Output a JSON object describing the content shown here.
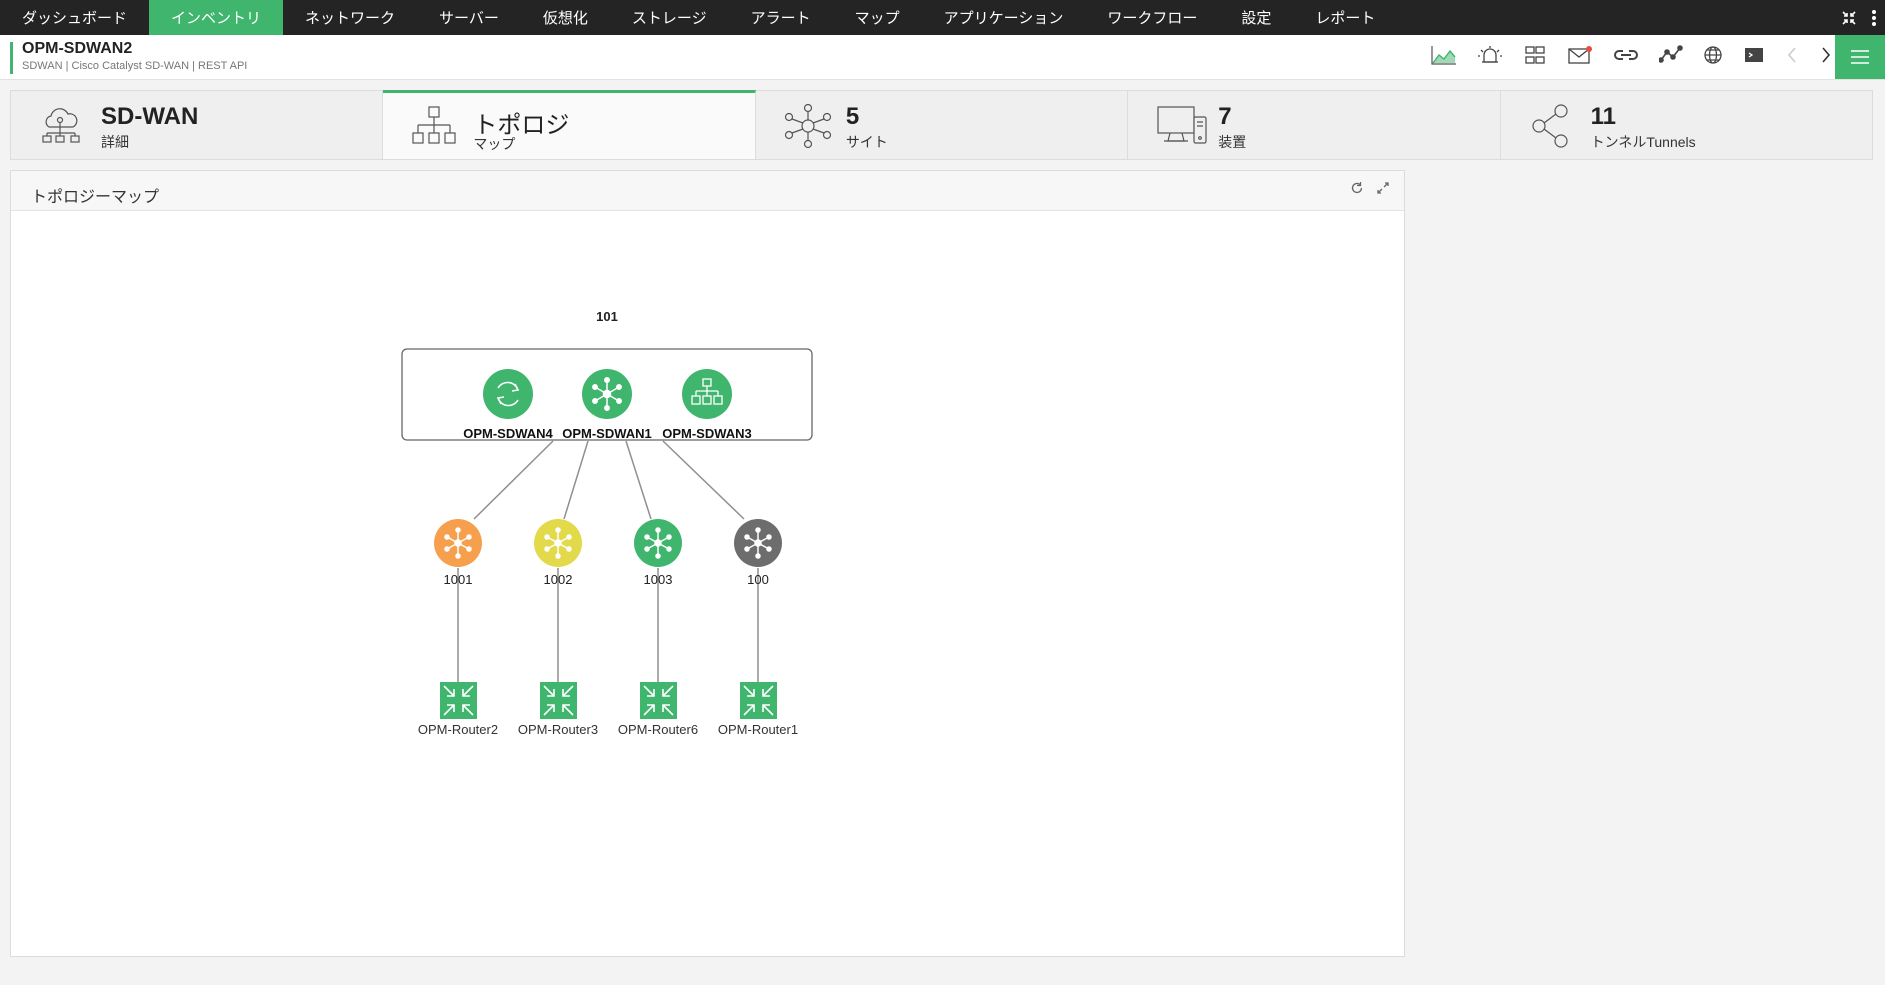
{
  "nav": {
    "items": [
      "ダッシュボード",
      "インベントリ",
      "ネットワーク",
      "サーバー",
      "仮想化",
      "ストレージ",
      "アラート",
      "マップ",
      "アプリケーション",
      "ワークフロー",
      "設定",
      "レポート"
    ],
    "active_index": 1
  },
  "header": {
    "title": "OPM-SDWAN2",
    "subtitle": "SDWAN | Cisco Catalyst SD-WAN | REST API"
  },
  "summary": [
    {
      "value": "SD-WAN",
      "label": "詳細",
      "icon": "cloud-network-icon"
    },
    {
      "value": "トポロジ",
      "label": "マップ",
      "icon": "topology-icon"
    },
    {
      "value": "5",
      "label": "サイト",
      "icon": "hub-icon"
    },
    {
      "value": "7",
      "label": "装置",
      "icon": "devices-icon"
    },
    {
      "value": "11",
      "label": "トンネルTunnels",
      "icon": "share-icon"
    }
  ],
  "panel": {
    "title": "トポロジーマップ"
  },
  "topology": {
    "group_label": "101",
    "controllers": [
      {
        "name": "OPM-SDWAN4",
        "icon": "sync-icon",
        "color": "#3fb56e"
      },
      {
        "name": "OPM-SDWAN1",
        "icon": "hub-icon",
        "color": "#3fb56e"
      },
      {
        "name": "OPM-SDWAN3",
        "icon": "topology-icon",
        "color": "#3fb56e"
      }
    ],
    "sites": [
      {
        "name": "1001",
        "color": "#f6a04d"
      },
      {
        "name": "1002",
        "color": "#e2d94b"
      },
      {
        "name": "1003",
        "color": "#3fb56e"
      },
      {
        "name": "100",
        "color": "#6d6d6d"
      }
    ],
    "routers": [
      "OPM-Router2",
      "OPM-Router3",
      "OPM-Router6",
      "OPM-Router1"
    ]
  },
  "colors": {
    "accent": "#3fb56e",
    "nav_bg": "#242424"
  }
}
